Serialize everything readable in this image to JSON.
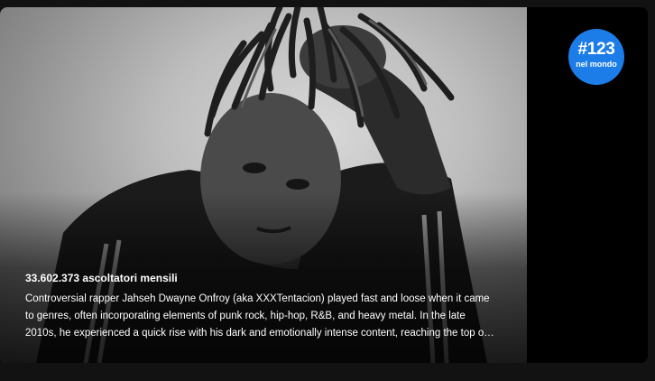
{
  "artist_about": {
    "photo_icon": "artist-portrait",
    "rank": {
      "number": "#123",
      "label": "nel mondo",
      "color": "#1d7de8"
    },
    "monthly_listeners": "33.602.373 ascoltatori mensili",
    "bio": "Controversial rapper Jahseh Dwayne Onfroy (aka XXXTentacion) played fast and loose when it came to genres, often incorporating elements of punk rock, hip-hop, R&B, and heavy metal. In the late 2010s, he experienced a quick rise with his dark and emotionally intense content, reaching the top of the charts with his second album and earning a loyal following."
  }
}
